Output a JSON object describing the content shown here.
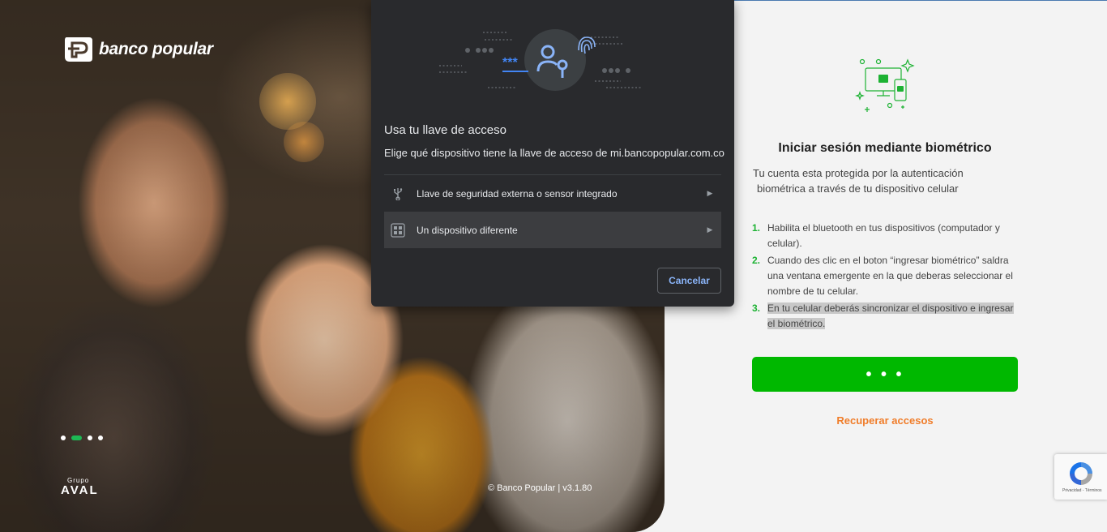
{
  "brand": {
    "name": "banco popular",
    "group_label": "Grupo",
    "group_name": "AVAL",
    "copyright": "© Banco Popular | v3.1.80"
  },
  "carousel": {
    "slide_count": 4,
    "active_index": 1
  },
  "passkey_dialog": {
    "title": "Usa tu llave de acceso",
    "subtitle": "Elige qué dispositivo tiene la llave de acceso de mi.bancopopular.com.co",
    "options": [
      {
        "label": "Llave de seguridad externa o sensor integrado",
        "icon": "usb-icon"
      },
      {
        "label": "Un dispositivo diferente",
        "icon": "qr-code-icon"
      }
    ],
    "cancel_label": "Cancelar",
    "password_mask": "***"
  },
  "panel": {
    "title": "Iniciar sesión mediante biométrico",
    "description_line1": "Tu cuenta esta protegida por la autenticación",
    "description_line2": "biométrica a través de tu dispositivo celular",
    "steps": [
      {
        "number": "1.",
        "text": "Habilita el bluetooth en tus dispositivos (computador y celular)."
      },
      {
        "number": "2.",
        "text": "Cuando des clic en el boton “ingresar biométrico” saldra una ventana emergente en la que deberas seleccionar el nombre de tu celular."
      },
      {
        "number": "3.",
        "text": "En tu celular deberás sincronizar el dispositivo e ingresar el biométrico."
      }
    ],
    "primary_button_label": "• • •",
    "recover_link": "Recuperar accesos"
  },
  "recaptcha": {
    "terms_text": "Privacidad - Términos"
  },
  "colors": {
    "primary_green": "#00b800",
    "step_green": "#1db233",
    "link_orange": "#f07d2a",
    "dialog_bg": "#292a2d",
    "dialog_accent": "#8ab4f8"
  }
}
